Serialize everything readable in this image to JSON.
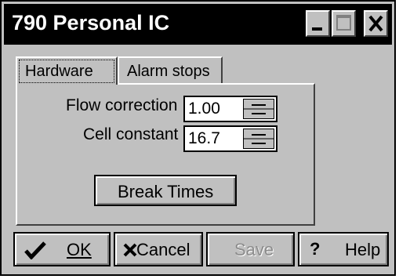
{
  "window": {
    "title": "790 Personal IC"
  },
  "titlebar_buttons": {
    "minimize_icon": "minimize-icon",
    "maximize_icon": "maximize-icon",
    "close_icon": "close-icon"
  },
  "tabs": [
    {
      "label": "Hardware",
      "active": true
    },
    {
      "label": "Alarm stops",
      "active": false
    }
  ],
  "fields": {
    "flow_correction": {
      "label": "Flow correction",
      "value": "1.00"
    },
    "cell_constant": {
      "label": "Cell constant",
      "value": "16.7"
    }
  },
  "break_times": {
    "label": "Break Times"
  },
  "footer": {
    "ok_label": "OK",
    "cancel_label": "Cancel",
    "save_label": "Save",
    "help_label": "Help",
    "ok_icon": "checkmark-icon",
    "cancel_icon": "x-icon",
    "help_icon": "question-icon"
  },
  "colors": {
    "face": "#c0c0c0",
    "titlebar": "#000000",
    "title_text": "#ffffff",
    "disabled_text": "#8c8c8c"
  }
}
